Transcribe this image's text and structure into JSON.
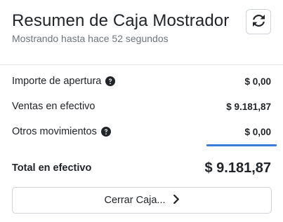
{
  "header": {
    "title": "Resumen de Caja Mostrador",
    "subtitle": "Mostrando hasta hace 52 segundos",
    "refresh_icon": "refresh-icon"
  },
  "rows": [
    {
      "label": "Importe de apertura",
      "value": "$ 0,00",
      "help_icon": "question-circle-icon"
    },
    {
      "label": "Ventas en efectivo",
      "value": "$ 9.181,87"
    },
    {
      "label": "Otros movimientos",
      "value": "$ 0,00",
      "help_icon": "question-circle-icon"
    }
  ],
  "total": {
    "label": "Total en efectivo",
    "value": "$ 9.181,87"
  },
  "close_button": {
    "label": "Cerrar Caja...",
    "icon": "chevron-right-icon"
  },
  "colors": {
    "accent": "#3a7bd5",
    "muted_text": "#6c757d",
    "border": "#ced4da"
  }
}
